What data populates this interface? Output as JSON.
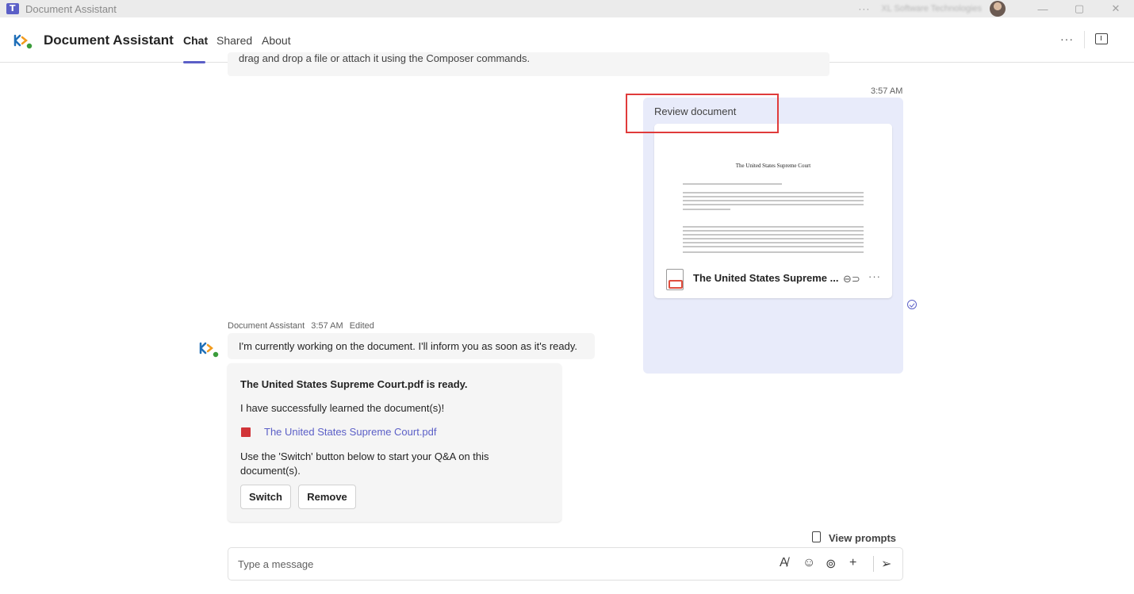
{
  "window": {
    "title": "Document Assistant",
    "org_name": "XL Software Technologies",
    "more_label": "···",
    "minimize": "—",
    "maximize": "▢",
    "close": "✕"
  },
  "header": {
    "app_name": "Document Assistant",
    "tabs": [
      {
        "label": "Chat",
        "active": true
      },
      {
        "label": "Shared",
        "active": false
      },
      {
        "label": "About",
        "active": false
      }
    ],
    "more_label": "···"
  },
  "colors": {
    "accent": "#5b5fc7",
    "outgoing_bubble": "#e8ebfa",
    "highlight": "#e03b3b",
    "pdf_red": "#d13438"
  },
  "chat": {
    "previous_message_fragment": "drag and drop a file or attach it using the Composer commands.",
    "outgoing": {
      "time": "3:57 AM",
      "text": "Review document",
      "attachment": {
        "preview_title": "The United States Supreme Court",
        "file_name": "The United States Supreme ...",
        "icon": "pdf-file-icon"
      }
    },
    "bot": {
      "sender": "Document Assistant",
      "time": "3:57 AM",
      "status": "Edited",
      "message": "I'm currently working on the document. I'll inform you as soon as it's ready.",
      "card": {
        "title": "The United States Supreme Court.pdf is ready.",
        "text": "I have successfully learned the document(s)!",
        "file_link": "The United States Supreme Court.pdf",
        "instruction": "Use the 'Switch' button below to start your Q&A on this document(s).",
        "buttons": {
          "switch": "Switch",
          "remove": "Remove"
        }
      }
    }
  },
  "composer": {
    "view_prompts": "View prompts",
    "placeholder": "Type a message"
  }
}
